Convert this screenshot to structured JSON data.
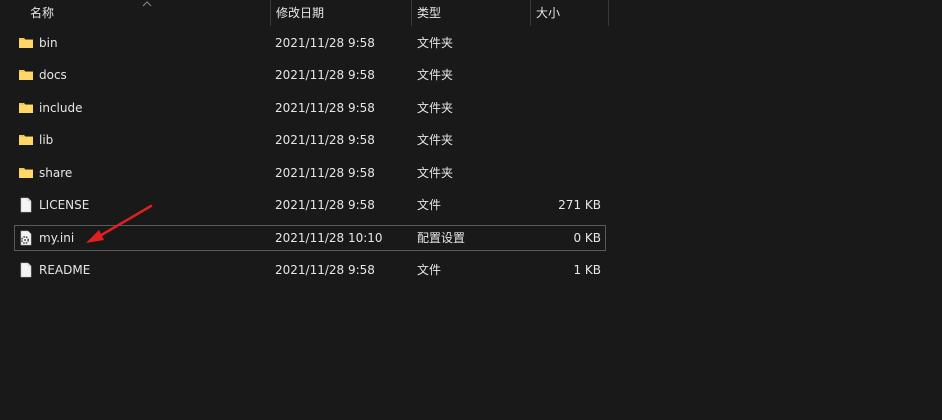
{
  "columns": {
    "name": "名称",
    "date": "修改日期",
    "type": "类型",
    "size": "大小"
  },
  "files": [
    {
      "name": "bin",
      "date": "2021/11/28 9:58",
      "type": "文件夹",
      "size": "",
      "icon": "folder-icon"
    },
    {
      "name": "docs",
      "date": "2021/11/28 9:58",
      "type": "文件夹",
      "size": "",
      "icon": "folder-icon"
    },
    {
      "name": "include",
      "date": "2021/11/28 9:58",
      "type": "文件夹",
      "size": "",
      "icon": "folder-icon"
    },
    {
      "name": "lib",
      "date": "2021/11/28 9:58",
      "type": "文件夹",
      "size": "",
      "icon": "folder-icon"
    },
    {
      "name": "share",
      "date": "2021/11/28 9:58",
      "type": "文件夹",
      "size": "",
      "icon": "folder-icon"
    },
    {
      "name": "LICENSE",
      "date": "2021/11/28 9:58",
      "type": "文件",
      "size": "271 KB",
      "icon": "file-icon"
    },
    {
      "name": "my.ini",
      "date": "2021/11/28 10:10",
      "type": "配置设置",
      "size": "0 KB",
      "icon": "settings-file-icon",
      "selected": true
    },
    {
      "name": "README",
      "date": "2021/11/28 9:58",
      "type": "文件",
      "size": "1 KB",
      "icon": "file-icon"
    }
  ],
  "colors": {
    "background": "#191919",
    "folder": "#f7c948",
    "annotation_arrow": "#e02020"
  }
}
